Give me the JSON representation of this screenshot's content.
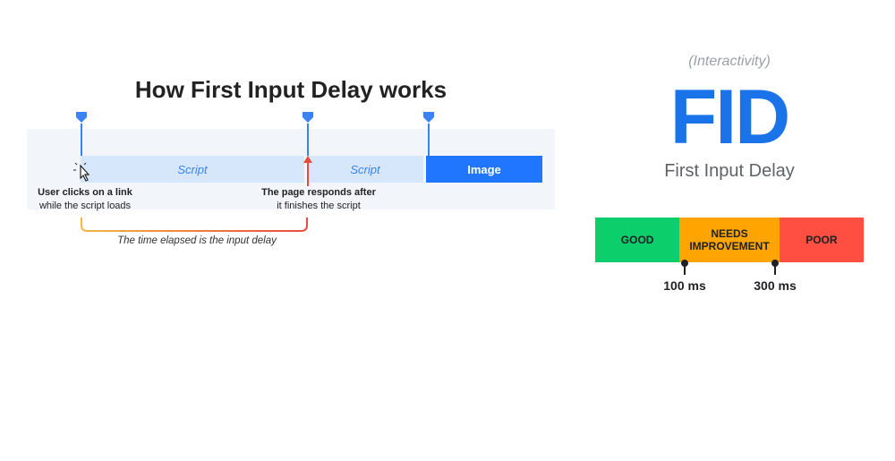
{
  "left": {
    "title": "How First Input Delay works",
    "segments": {
      "script1": "Script",
      "script2": "Script",
      "image": "Image"
    },
    "ann_click_bold": "User clicks on a link",
    "ann_click_sub": "while the script loads",
    "ann_respond_bold": "The page responds after",
    "ann_respond_sub": "it finishes the script",
    "caption": "The time elapsed is the input delay"
  },
  "right": {
    "overline": "(Interactivity)",
    "acronym": "FID",
    "subtitle": "First Input Delay",
    "score": {
      "good": "GOOD",
      "needs": "NEEDS IMPROVEMENT",
      "poor": "POOR",
      "t1": "100 ms",
      "t2": "300 ms"
    }
  }
}
